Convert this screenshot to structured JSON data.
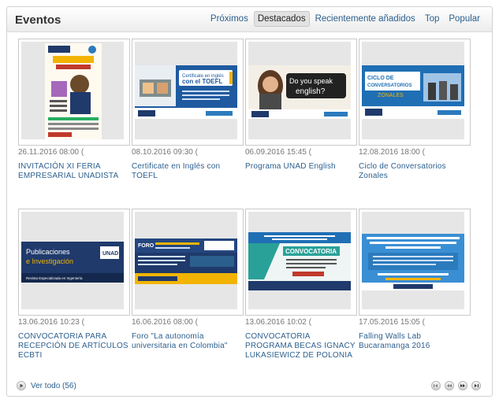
{
  "header": {
    "title": "Eventos",
    "tabs": [
      {
        "label": "Próximos",
        "active": false
      },
      {
        "label": "Destacados",
        "active": true
      },
      {
        "label": "Recientemente añadidos",
        "active": false
      },
      {
        "label": "Top",
        "active": false
      },
      {
        "label": "Popular",
        "active": false
      }
    ]
  },
  "events": [
    {
      "date": "26.11.2016 08:00 (",
      "title": "INVITACIÓN XI FERIA EMPRESARIAL UNADISTA",
      "poster": {
        "heading": "XI FERIA EMPRESARIAL UNADISTA",
        "brand": "UNAD"
      }
    },
    {
      "date": "08.10.2016 09:30 (",
      "title": "Certificate en Inglés con TOEFL",
      "poster": {
        "heading": "Certificate en inglés con el TOEFL!",
        "brand": "UNAD"
      }
    },
    {
      "date": "06.09.2016 15:45 (",
      "title": "Programa UNAD English",
      "poster": {
        "heading": "Do you speak english?",
        "brand": "UNAD"
      }
    },
    {
      "date": "12.08.2016 18:00 (",
      "title": "Ciclo de Conversatorios Zonales",
      "poster": {
        "heading": "CICLO DE CONVERSATORIOS ZONALES",
        "brand": "UNAD"
      }
    },
    {
      "date": "13.06.2016 10:23 (",
      "title": "CONVOCATORIA PARA RECEPCIÓN DE ARTÍCULOS ECBTI",
      "poster": {
        "heading": "Publicaciones e Investigación",
        "subheading": "Revista Especializada en Ingeniería",
        "brand": "UNAD"
      }
    },
    {
      "date": "16.06.2016 08:00 (",
      "title": "Foro \"La autonomía universitaria en Colombia\"",
      "poster": {
        "heading": "FORO",
        "brand": "UNAD"
      }
    },
    {
      "date": "13.06.2016 10:02 (",
      "title": "CONVOCATORIA PROGRAMA BECAS IGNACY LUKASIEWICZ DE POLONIA",
      "poster": {
        "heading": "CONVOCATORIA",
        "brand": "UNAD"
      }
    },
    {
      "date": "17.05.2016 15:05 (",
      "title": "Falling Walls Lab Bucaramanga 2016",
      "poster": {
        "heading": "La VIREI invita a participar en la Convocatoria Falling Walls Lab Bucaramanga 2016",
        "brand": "UNAD"
      }
    }
  ],
  "footer": {
    "see_all": "Ver todo (56)",
    "pager_icons": [
      "first-page-icon",
      "prev-page-icon",
      "next-page-icon",
      "last-page-icon"
    ]
  },
  "colors": {
    "link": "#2b5f8e",
    "unad_blue": "#1f3a6b",
    "accent_yellow": "#f2b400"
  }
}
